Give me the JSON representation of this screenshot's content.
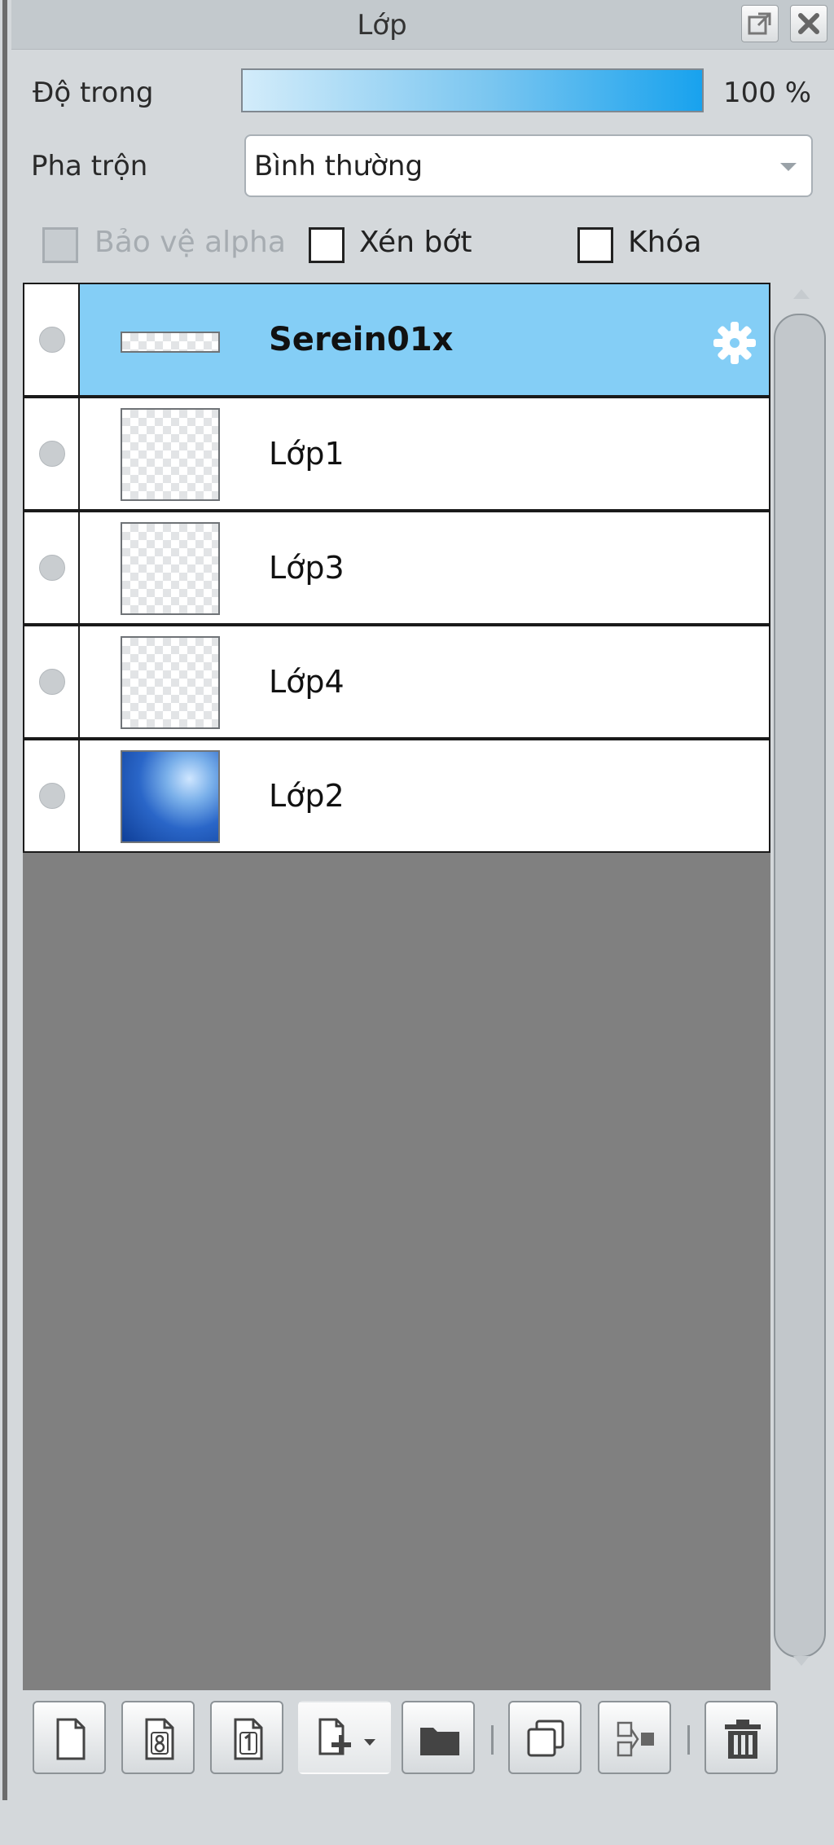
{
  "panel": {
    "title": "Lớp"
  },
  "opacity": {
    "label": "Độ trong",
    "value_text": "100 %",
    "value": 100
  },
  "blend": {
    "label": "Pha trộn",
    "selected": "Bình thường"
  },
  "options": {
    "protect_alpha": "Bảo vệ alpha",
    "clip": "Xén bớt",
    "lock": "Khóa"
  },
  "layers": [
    {
      "name": "Serein01x",
      "selected": true,
      "thumb": "folder"
    },
    {
      "name": "Lớp1",
      "selected": false,
      "thumb": "transparent"
    },
    {
      "name": "Lớp3",
      "selected": false,
      "thumb": "transparent"
    },
    {
      "name": "Lớp4",
      "selected": false,
      "thumb": "transparent"
    },
    {
      "name": "Lớp2",
      "selected": false,
      "thumb": "sky"
    }
  ],
  "toolbar_icons": [
    "new-layer-icon",
    "new-8bit-layer-icon",
    "new-1bit-layer-icon",
    "new-layer-menu-icon",
    "new-folder-icon",
    "duplicate-layer-icon",
    "merge-down-icon",
    "delete-layer-icon"
  ],
  "colors": {
    "selected_row": "#84cef6",
    "slider_fill": "#18a2ee"
  }
}
